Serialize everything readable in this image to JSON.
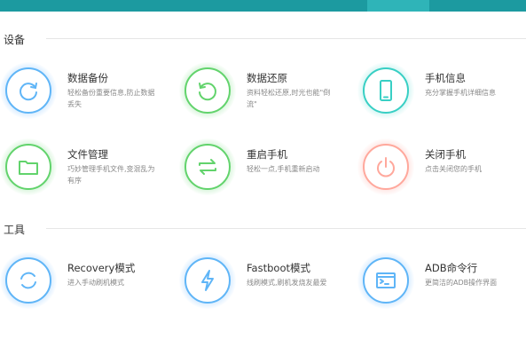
{
  "sections": {
    "device": {
      "title": "设备",
      "items": [
        {
          "title": "数据备份",
          "desc": "轻松备份重要信息,防止数据丢失",
          "icon": "backup-sync-icon",
          "color": "#5fb5f7"
        },
        {
          "title": "数据还原",
          "desc": "资料轻松还原,时光也能\"倒流\"",
          "icon": "restore-undo-icon",
          "color": "#62d36c"
        },
        {
          "title": "手机信息",
          "desc": "充分掌握手机详细信息",
          "icon": "phone-icon",
          "color": "#38cfc4"
        },
        {
          "title": "文件管理",
          "desc": "巧妙管理手机文件,变混乱为有序",
          "icon": "folder-icon",
          "color": "#62d36c"
        },
        {
          "title": "重启手机",
          "desc": "轻松一点,手机重新启动",
          "icon": "reboot-arrows-icon",
          "color": "#62d36c"
        },
        {
          "title": "关闭手机",
          "desc": "点击关闭您的手机",
          "icon": "power-icon",
          "color": "#ffa89c"
        }
      ]
    },
    "tools": {
      "title": "工具",
      "items": [
        {
          "title": "Recovery模式",
          "desc": "进入手动刷机模式",
          "icon": "recovery-refresh-icon",
          "color": "#5fb5f7"
        },
        {
          "title": "Fastboot模式",
          "desc": "线刷模式,刷机发烧友最爱",
          "icon": "lightning-icon",
          "color": "#5fb5f7"
        },
        {
          "title": "ADB命令行",
          "desc": "更简洁的ADB操作界面",
          "icon": "terminal-icon",
          "color": "#5fb5f7"
        }
      ]
    }
  }
}
